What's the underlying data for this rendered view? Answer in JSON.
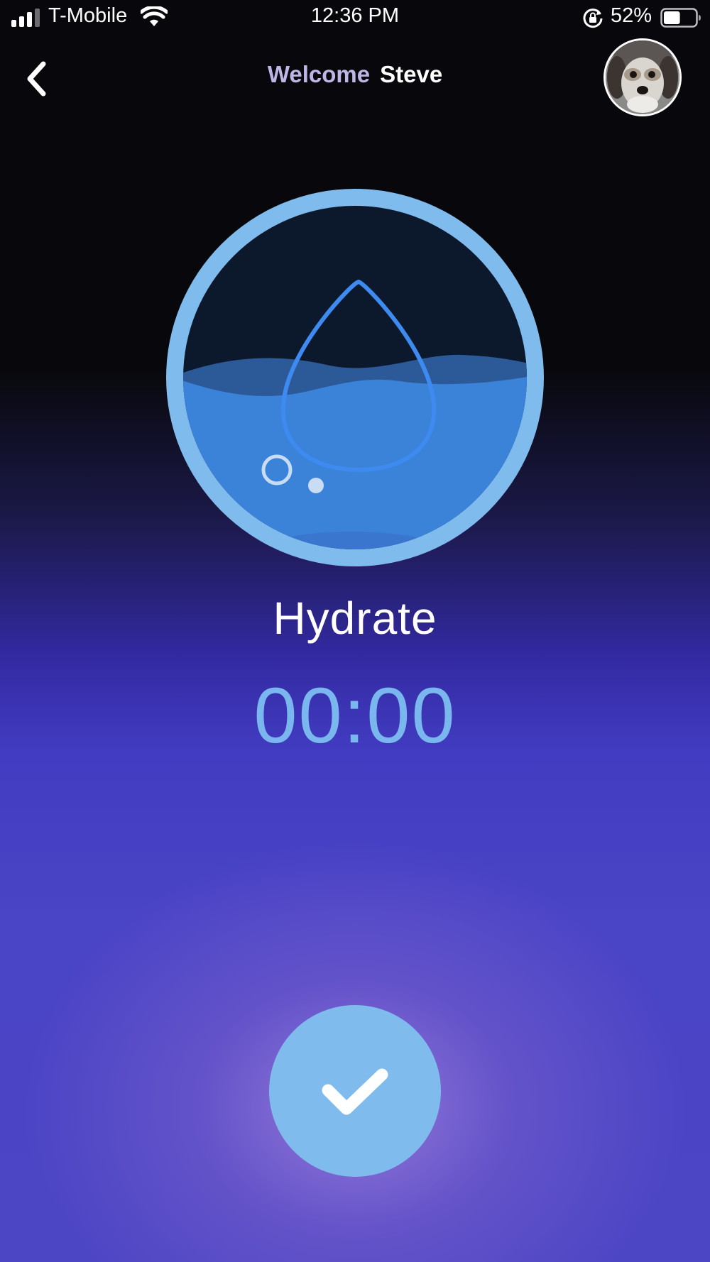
{
  "status_bar": {
    "carrier": "T-Mobile",
    "time": "12:36 PM",
    "battery_percent": "52%",
    "battery_level": 0.52
  },
  "header": {
    "welcome_label": "Welcome",
    "user_name": "Steve"
  },
  "activity": {
    "title": "Hydrate",
    "timer": "00:00"
  },
  "colors": {
    "accent": "#7fbbec",
    "water": "#3b82d9",
    "timer_text": "#7ab7ee"
  },
  "icons": {
    "back": "chevron-left-icon",
    "activity": "water-drop-icon",
    "complete": "checkmark-icon"
  }
}
